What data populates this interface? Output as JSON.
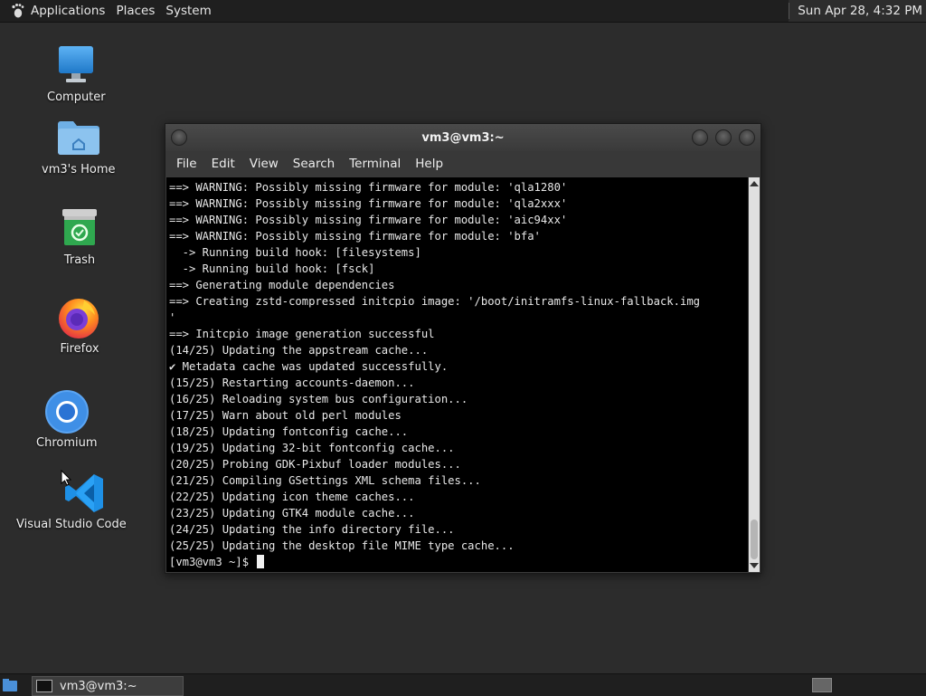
{
  "top_panel": {
    "menus": [
      "Applications",
      "Places",
      "System"
    ],
    "clock": "Sun Apr 28,  4:32 PM"
  },
  "desktop": {
    "icons": [
      {
        "label": "Computer",
        "icon": "computer-icon"
      },
      {
        "label": "vm3's Home",
        "icon": "home-folder-icon"
      },
      {
        "label": "Trash",
        "icon": "trash-icon"
      },
      {
        "label": "Firefox",
        "icon": "firefox-icon"
      },
      {
        "label": "Chromium",
        "icon": "chromium-icon"
      },
      {
        "label": "Visual Studio Code",
        "icon": "vscode-icon"
      }
    ]
  },
  "terminal": {
    "title": "vm3@vm3:~",
    "menu": [
      "File",
      "Edit",
      "View",
      "Search",
      "Terminal",
      "Help"
    ],
    "lines": [
      "==> WARNING: Possibly missing firmware for module: 'qla1280'",
      "==> WARNING: Possibly missing firmware for module: 'qla2xxx'",
      "==> WARNING: Possibly missing firmware for module: 'aic94xx'",
      "==> WARNING: Possibly missing firmware for module: 'bfa'",
      "  -> Running build hook: [filesystems]",
      "  -> Running build hook: [fsck]",
      "==> Generating module dependencies",
      "==> Creating zstd-compressed initcpio image: '/boot/initramfs-linux-fallback.img",
      "'",
      "==> Initcpio image generation successful",
      "(14/25) Updating the appstream cache...",
      "✔ Metadata cache was updated successfully.",
      "(15/25) Restarting accounts-daemon...",
      "(16/25) Reloading system bus configuration...",
      "(17/25) Warn about old perl modules",
      "(18/25) Updating fontconfig cache...",
      "(19/25) Updating 32-bit fontconfig cache...",
      "(20/25) Probing GDK-Pixbuf loader modules...",
      "(21/25) Compiling GSettings XML schema files...",
      "(22/25) Updating icon theme caches...",
      "(23/25) Updating GTK4 module cache...",
      "(24/25) Updating the info directory file...",
      "(25/25) Updating the desktop file MIME type cache..."
    ],
    "prompt": "[vm3@vm3 ~]$ "
  },
  "bottom_panel": {
    "task_label": "vm3@vm3:~"
  },
  "colors": {
    "desktop_bg": "#2c2c2c",
    "panel_bg": "#1f1f1f",
    "terminal_bg": "#000000",
    "terminal_fg": "#e8e8e8"
  }
}
